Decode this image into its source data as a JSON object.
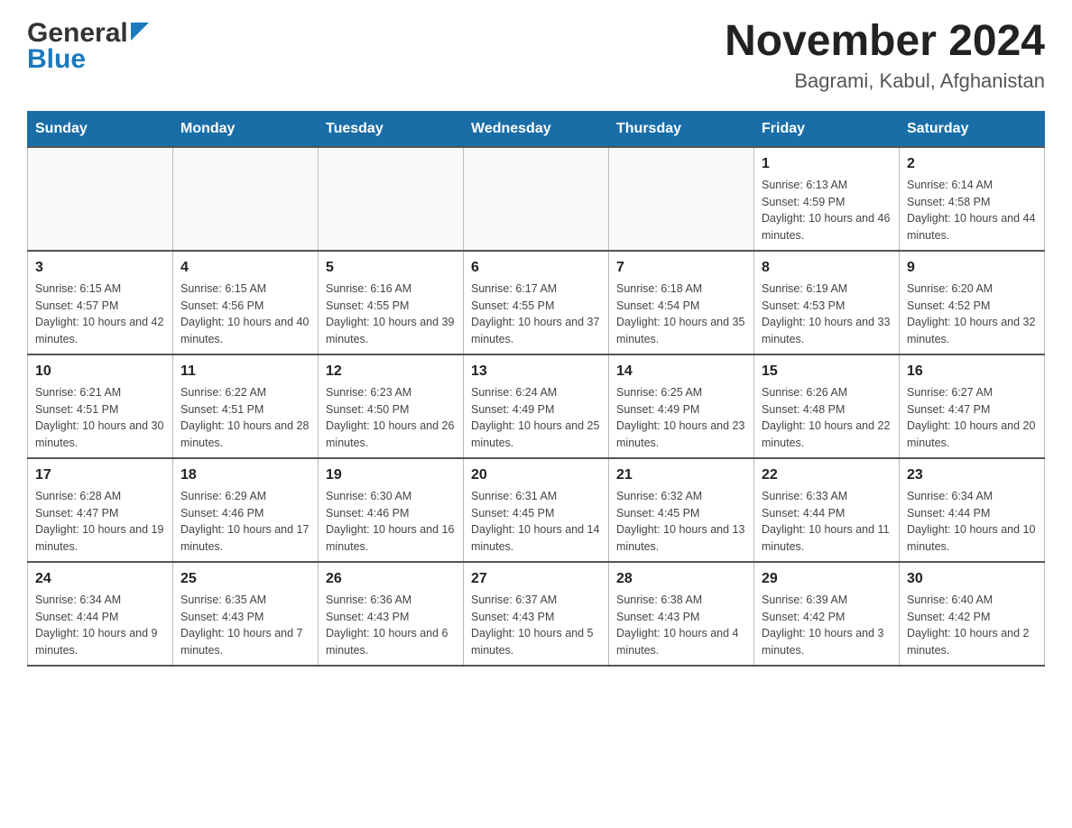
{
  "header": {
    "logo_general": "General",
    "logo_blue": "Blue",
    "month_title": "November 2024",
    "location": "Bagrami, Kabul, Afghanistan"
  },
  "calendar": {
    "days_of_week": [
      "Sunday",
      "Monday",
      "Tuesday",
      "Wednesday",
      "Thursday",
      "Friday",
      "Saturday"
    ],
    "weeks": [
      [
        {
          "day": "",
          "info": ""
        },
        {
          "day": "",
          "info": ""
        },
        {
          "day": "",
          "info": ""
        },
        {
          "day": "",
          "info": ""
        },
        {
          "day": "",
          "info": ""
        },
        {
          "day": "1",
          "info": "Sunrise: 6:13 AM\nSunset: 4:59 PM\nDaylight: 10 hours and 46 minutes."
        },
        {
          "day": "2",
          "info": "Sunrise: 6:14 AM\nSunset: 4:58 PM\nDaylight: 10 hours and 44 minutes."
        }
      ],
      [
        {
          "day": "3",
          "info": "Sunrise: 6:15 AM\nSunset: 4:57 PM\nDaylight: 10 hours and 42 minutes."
        },
        {
          "day": "4",
          "info": "Sunrise: 6:15 AM\nSunset: 4:56 PM\nDaylight: 10 hours and 40 minutes."
        },
        {
          "day": "5",
          "info": "Sunrise: 6:16 AM\nSunset: 4:55 PM\nDaylight: 10 hours and 39 minutes."
        },
        {
          "day": "6",
          "info": "Sunrise: 6:17 AM\nSunset: 4:55 PM\nDaylight: 10 hours and 37 minutes."
        },
        {
          "day": "7",
          "info": "Sunrise: 6:18 AM\nSunset: 4:54 PM\nDaylight: 10 hours and 35 minutes."
        },
        {
          "day": "8",
          "info": "Sunrise: 6:19 AM\nSunset: 4:53 PM\nDaylight: 10 hours and 33 minutes."
        },
        {
          "day": "9",
          "info": "Sunrise: 6:20 AM\nSunset: 4:52 PM\nDaylight: 10 hours and 32 minutes."
        }
      ],
      [
        {
          "day": "10",
          "info": "Sunrise: 6:21 AM\nSunset: 4:51 PM\nDaylight: 10 hours and 30 minutes."
        },
        {
          "day": "11",
          "info": "Sunrise: 6:22 AM\nSunset: 4:51 PM\nDaylight: 10 hours and 28 minutes."
        },
        {
          "day": "12",
          "info": "Sunrise: 6:23 AM\nSunset: 4:50 PM\nDaylight: 10 hours and 26 minutes."
        },
        {
          "day": "13",
          "info": "Sunrise: 6:24 AM\nSunset: 4:49 PM\nDaylight: 10 hours and 25 minutes."
        },
        {
          "day": "14",
          "info": "Sunrise: 6:25 AM\nSunset: 4:49 PM\nDaylight: 10 hours and 23 minutes."
        },
        {
          "day": "15",
          "info": "Sunrise: 6:26 AM\nSunset: 4:48 PM\nDaylight: 10 hours and 22 minutes."
        },
        {
          "day": "16",
          "info": "Sunrise: 6:27 AM\nSunset: 4:47 PM\nDaylight: 10 hours and 20 minutes."
        }
      ],
      [
        {
          "day": "17",
          "info": "Sunrise: 6:28 AM\nSunset: 4:47 PM\nDaylight: 10 hours and 19 minutes."
        },
        {
          "day": "18",
          "info": "Sunrise: 6:29 AM\nSunset: 4:46 PM\nDaylight: 10 hours and 17 minutes."
        },
        {
          "day": "19",
          "info": "Sunrise: 6:30 AM\nSunset: 4:46 PM\nDaylight: 10 hours and 16 minutes."
        },
        {
          "day": "20",
          "info": "Sunrise: 6:31 AM\nSunset: 4:45 PM\nDaylight: 10 hours and 14 minutes."
        },
        {
          "day": "21",
          "info": "Sunrise: 6:32 AM\nSunset: 4:45 PM\nDaylight: 10 hours and 13 minutes."
        },
        {
          "day": "22",
          "info": "Sunrise: 6:33 AM\nSunset: 4:44 PM\nDaylight: 10 hours and 11 minutes."
        },
        {
          "day": "23",
          "info": "Sunrise: 6:34 AM\nSunset: 4:44 PM\nDaylight: 10 hours and 10 minutes."
        }
      ],
      [
        {
          "day": "24",
          "info": "Sunrise: 6:34 AM\nSunset: 4:44 PM\nDaylight: 10 hours and 9 minutes."
        },
        {
          "day": "25",
          "info": "Sunrise: 6:35 AM\nSunset: 4:43 PM\nDaylight: 10 hours and 7 minutes."
        },
        {
          "day": "26",
          "info": "Sunrise: 6:36 AM\nSunset: 4:43 PM\nDaylight: 10 hours and 6 minutes."
        },
        {
          "day": "27",
          "info": "Sunrise: 6:37 AM\nSunset: 4:43 PM\nDaylight: 10 hours and 5 minutes."
        },
        {
          "day": "28",
          "info": "Sunrise: 6:38 AM\nSunset: 4:43 PM\nDaylight: 10 hours and 4 minutes."
        },
        {
          "day": "29",
          "info": "Sunrise: 6:39 AM\nSunset: 4:42 PM\nDaylight: 10 hours and 3 minutes."
        },
        {
          "day": "30",
          "info": "Sunrise: 6:40 AM\nSunset: 4:42 PM\nDaylight: 10 hours and 2 minutes."
        }
      ]
    ]
  }
}
